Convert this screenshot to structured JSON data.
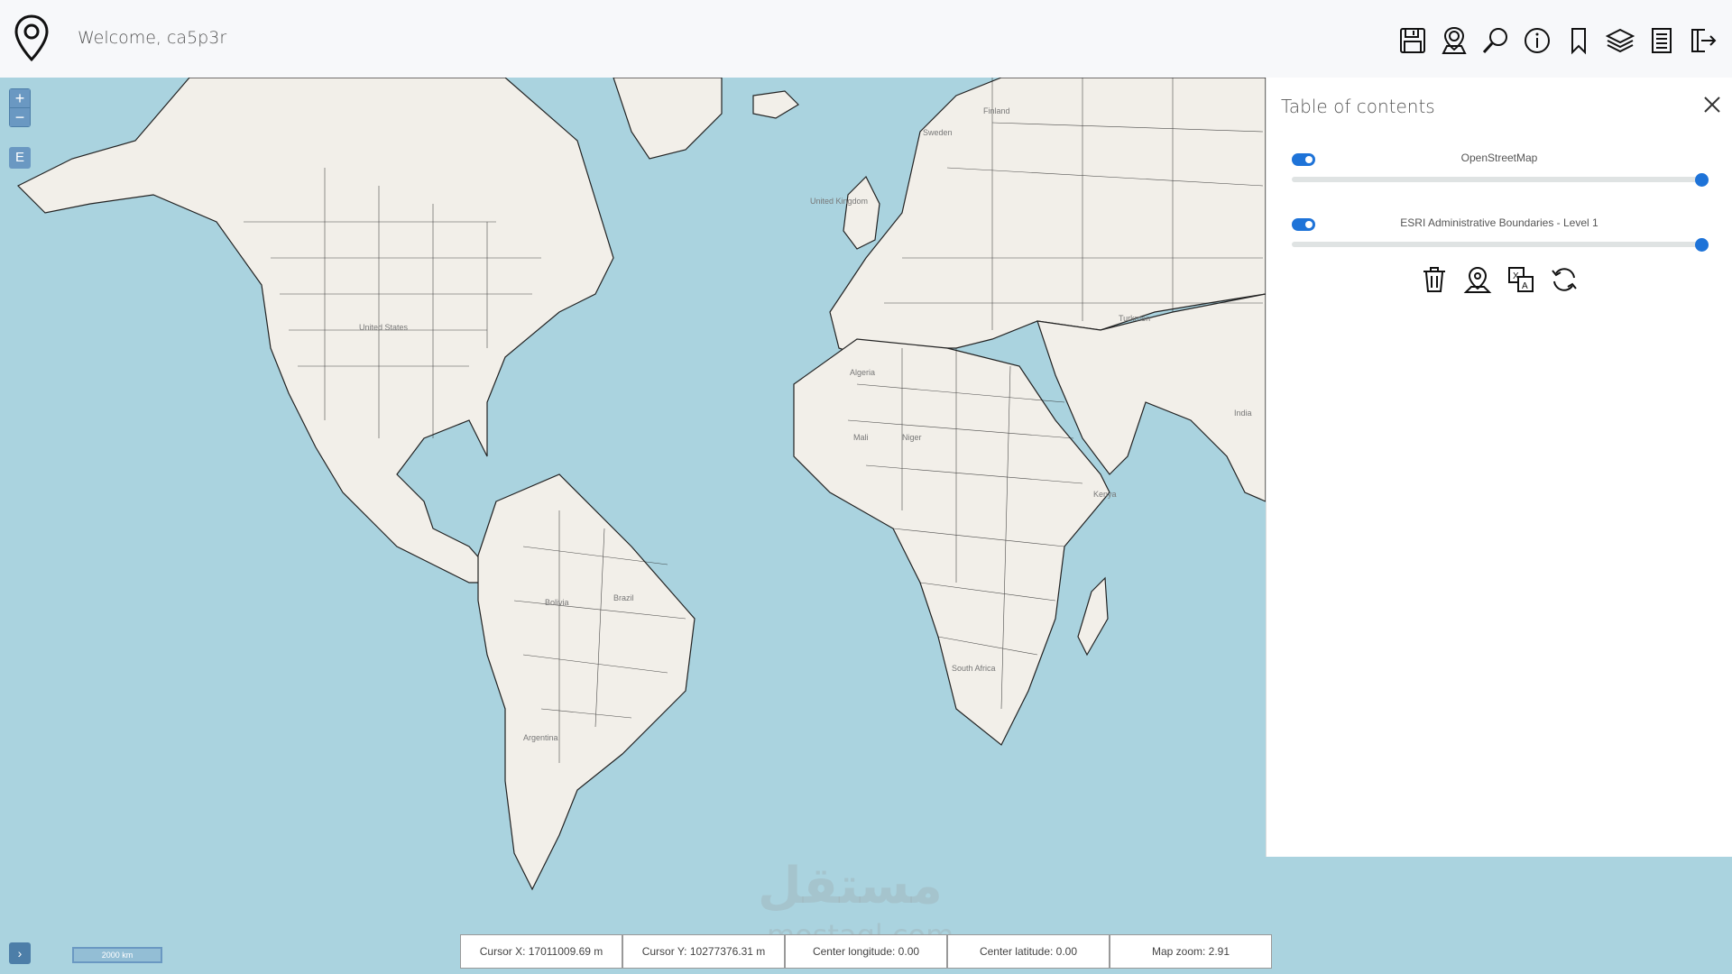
{
  "header": {
    "welcome": "Welcome, ca5p3r",
    "toolbar": [
      {
        "icon": "save-icon"
      },
      {
        "icon": "user-location-icon"
      },
      {
        "icon": "search-icon"
      },
      {
        "icon": "info-icon"
      },
      {
        "icon": "bookmark-icon"
      },
      {
        "icon": "layers-icon"
      },
      {
        "icon": "list-icon"
      },
      {
        "icon": "logout-icon"
      }
    ]
  },
  "map": {
    "zoom_in": "+",
    "zoom_out": "−",
    "extent_button": "E",
    "labels": {
      "united_states": "United States",
      "united_kingdom": "United Kingdom",
      "mali": "Mali",
      "niger": "Niger",
      "brazil": "Brazil",
      "bolivia": "Bolivia",
      "argentina": "Argentina",
      "algeria": "Algeria",
      "south_africa": "South Africa",
      "kenya": "Kenya",
      "india": "India",
      "turkmen": "Turkmen",
      "finland": "Finland",
      "sweden": "Sweden"
    },
    "scale": "2000 km",
    "expand": "›"
  },
  "toc": {
    "title": "Table of contents",
    "layers": [
      {
        "name": "OpenStreetMap",
        "enabled": true,
        "opacity": 1.0
      },
      {
        "name": "ESRI Administrative Boundaries - Level 1",
        "enabled": true,
        "opacity": 1.0
      }
    ],
    "actions": [
      {
        "icon": "trash-icon"
      },
      {
        "icon": "location-pin-icon"
      },
      {
        "icon": "translate-icon"
      },
      {
        "icon": "refresh-icon"
      }
    ]
  },
  "status": {
    "cursor_x": "Cursor X: 17011009.69 m",
    "cursor_y": "Cursor Y: 10277376.31 m",
    "center_lon": "Center longitude: 0.00",
    "center_lat": "Center latitude: 0.00",
    "zoom": "Map zoom: 2.91"
  },
  "watermark": {
    "arabic": "مستقل",
    "latin": "mostaql.com"
  },
  "colors": {
    "ocean": "#aad3df",
    "land": "#f2efe9",
    "accent": "#1e73d8"
  }
}
